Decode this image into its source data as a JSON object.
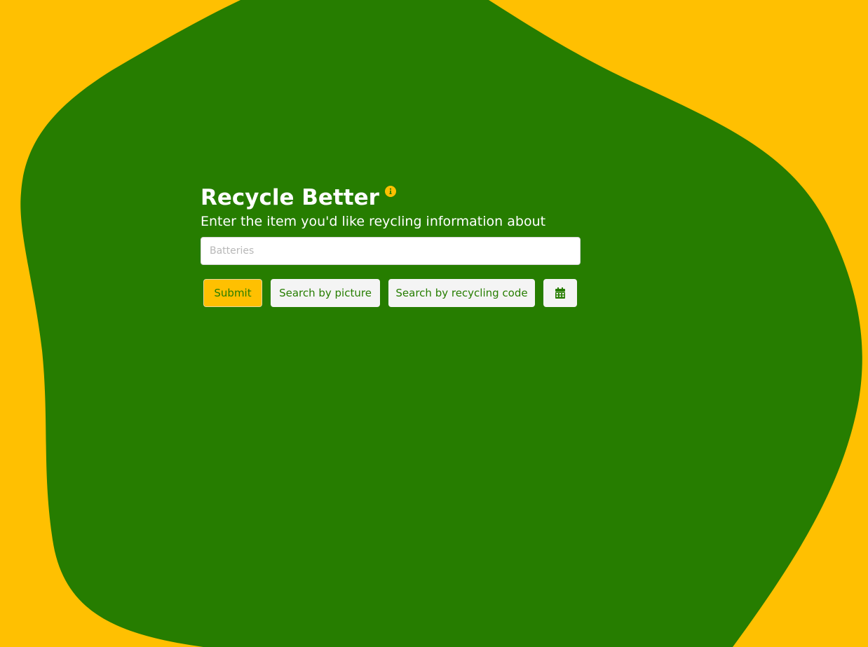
{
  "colors": {
    "background": "#ffc001",
    "blob": "#267d00",
    "accent": "#ffc001",
    "button_text": "#267d00"
  },
  "header": {
    "title": "Recycle Better",
    "info_icon": "info-circle-icon"
  },
  "search": {
    "prompt": "Enter the item you'd like reycling information about",
    "placeholder": "Batteries",
    "value": ""
  },
  "actions": {
    "submit_label": "Submit",
    "picture_label": "Search by picture",
    "code_label": "Search by recycling code",
    "calendar_icon": "calendar-icon"
  }
}
